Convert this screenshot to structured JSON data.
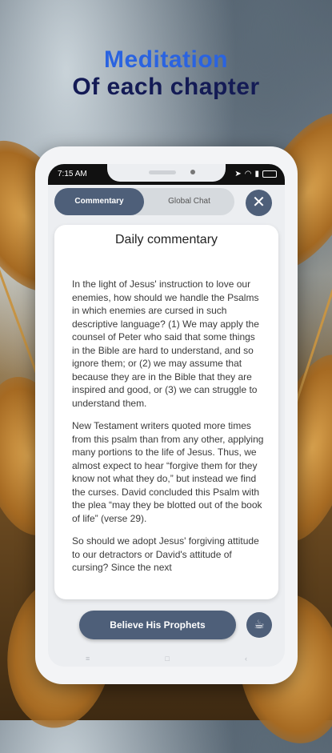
{
  "promo": {
    "line1": "Meditation",
    "line2": "Of each chapter"
  },
  "status_bar": {
    "time": "7:15 AM",
    "icons": [
      "navigation-icon",
      "wifi-icon",
      "signal-icon",
      "battery-icon"
    ]
  },
  "tabs": [
    {
      "label": "Commentary",
      "active": true
    },
    {
      "label": "Global Chat",
      "active": false
    }
  ],
  "close_icon": "close-icon",
  "card": {
    "title": "Daily commentary",
    "paragraphs": [
      "In the light of Jesus' instruction to love our enemies, how should we handle the Psalms in which enemies are cursed in such descriptive language? (1) We may apply the counsel of Peter who said that some things in the Bible are hard to understand, and so ignore them; or (2) we may assume that because they are in the Bible that they are inspired and good, or (3) we can struggle to understand them.",
      "New Testament writers quoted more times from this psalm than from any other, applying many portions to the life of Jesus. Thus, we almost expect to hear “forgive them for they know not what they do,” but instead we find the curses. David concluded this Psalm with the plea “may they be blotted out of the book of life” (verse 29).",
      "So should we adopt Jesus' forgiving attitude to our detractors or David's attitude of cursing? Since the next"
    ]
  },
  "bottom": {
    "button_label": "Believe His Prophets",
    "cup_icon": "coffee-cup-icon"
  },
  "nav_bar": [
    "menu-icon",
    "home-icon",
    "back-icon"
  ]
}
